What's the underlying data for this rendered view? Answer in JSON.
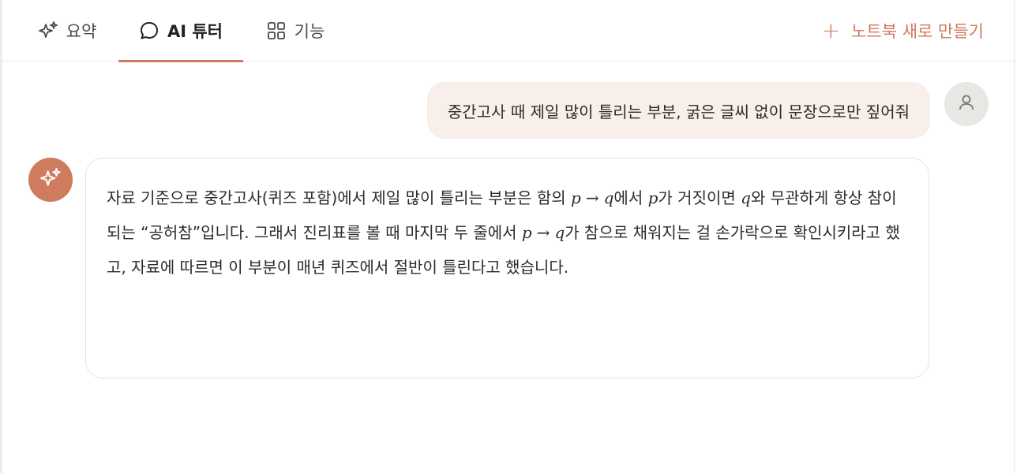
{
  "tabs": [
    {
      "label": "요약",
      "icon": "sparkle-icon",
      "active": false
    },
    {
      "label": "AI 튜터",
      "icon": "chat-bubble-icon",
      "active": true
    },
    {
      "label": "기능",
      "icon": "grid-icon",
      "active": false
    }
  ],
  "header": {
    "new_notebook_label": "노트북 새로 만들기",
    "plus": "+"
  },
  "chat": {
    "user_message": "중간고사 때 제일 많이 틀리는 부분, 굵은 글씨 없이 문장으로만 짚어줘",
    "ai_message": {
      "p1": "자료 기준으로 중간고사(퀴즈 포함)에서 제일 많이 틀리는 부분은 함의 ",
      "m1_p": "p",
      "m1_arrow": "→",
      "m1_q": "q",
      "p2": "에서 ",
      "m2_p": "p",
      "p3": "가 거짓이면 ",
      "m3_q": "q",
      "p4": "와 무관하게 항상 참이 되는 “공허참”입니다. 그래서 진리표를 볼 때 마지막 두 줄에서 ",
      "m4_p": "p",
      "m4_arrow": "→",
      "m4_q": "q",
      "p5": "가 참으로 채워지는 걸 손가락으로 확인시키라고 했고, 자료에 따르면 이 부분이 매년 퀴즈에서 절반이 틀린다고 했습니다."
    }
  },
  "colors": {
    "accent": "#cf7b5d",
    "user_bubble": "#f8efea",
    "avatar_bg": "#e9e7e3"
  }
}
